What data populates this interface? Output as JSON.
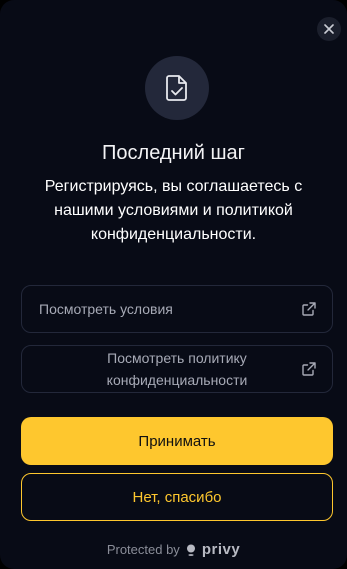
{
  "modal": {
    "title": "Последний шаг",
    "subtitle": "Регистрируясь, вы соглашаетесь с нашими условиями и политикой конфиденциальности.",
    "close_icon": "close-icon",
    "header_icon": "document-check-icon"
  },
  "links": {
    "terms_label": "Посмотреть условия",
    "policy_label": "Посмотреть политику конфиденциальности",
    "external_icon": "external-link-icon"
  },
  "actions": {
    "accept_label": "Принимать",
    "decline_label": "Нет, спасибо"
  },
  "footer": {
    "protected_by": "Protected by",
    "brand": "privy",
    "brand_icon": "privy-logo-icon"
  },
  "colors": {
    "background": "#080b16",
    "accent": "#fec72e",
    "border": "#23283a"
  }
}
